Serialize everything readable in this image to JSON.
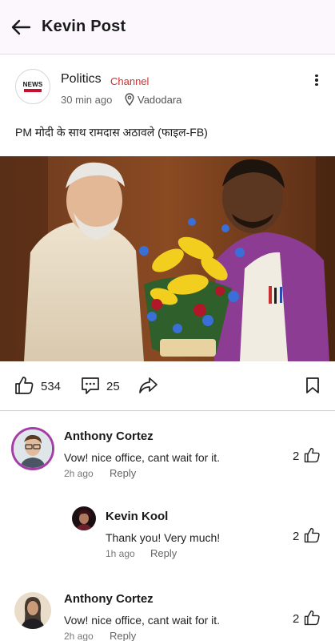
{
  "header": {
    "title": "Kevin Post"
  },
  "post": {
    "name": "Politics",
    "tag": "Channel",
    "time": "30 min ago",
    "location": "Vadodara",
    "logo_text": "NEWS",
    "caption": "PM मोदी के साथ रामदास अठावले (फाइल-FB)",
    "likes": "534",
    "comments": "25"
  },
  "comments": [
    {
      "name": "Anthony Cortez",
      "text": "Vow! nice office, cant wait for it.",
      "time": "2h ago",
      "reply": "Reply",
      "likes": "2"
    },
    {
      "name": "Kevin Kool",
      "text": "Thank you! Very much!",
      "time": "1h ago",
      "reply": "Reply",
      "likes": "2"
    },
    {
      "name": "Anthony Cortez",
      "text": "Vow! nice office, cant wait for it.",
      "time": "2h ago",
      "reply": "Reply",
      "likes": "2"
    }
  ],
  "colors": {
    "accent": "#d03030",
    "avatar_ring": "#a43ea6",
    "header_bg": "#fbf7fc"
  },
  "icons": [
    "back-arrow-icon",
    "location-pin-icon",
    "more-vertical-icon",
    "thumbs-up-icon",
    "comment-icon",
    "share-icon",
    "bookmark-icon"
  ]
}
